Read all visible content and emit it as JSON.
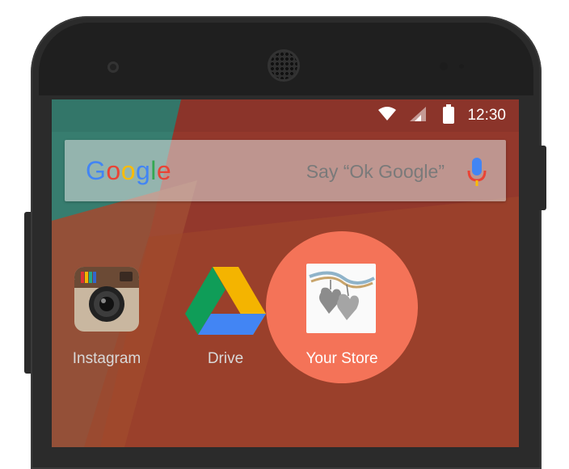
{
  "status_bar": {
    "time": "12:30",
    "icons": [
      "wifi-icon",
      "signal-icon",
      "battery-icon"
    ]
  },
  "search": {
    "logo": [
      "G",
      "o",
      "o",
      "g",
      "l",
      "e"
    ],
    "hint": "Say “Ok Google”",
    "mic_icon": "mic-icon"
  },
  "apps": [
    {
      "label": "Instagram",
      "icon": "instagram-icon"
    },
    {
      "label": "Drive",
      "icon": "drive-icon"
    },
    {
      "label": "Your Store",
      "icon": "your-store-icon"
    }
  ],
  "colors": {
    "highlight": "#f47358",
    "wallpaper_red": "#a84033",
    "wallpaper_teal": "#3f8f7f"
  }
}
